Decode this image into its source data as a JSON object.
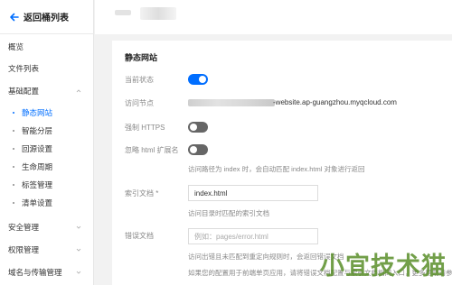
{
  "back": {
    "label": "返回桶列表"
  },
  "sidebar": {
    "items": [
      {
        "label": "概览"
      },
      {
        "label": "文件列表"
      },
      {
        "label": "基础配置"
      },
      {
        "label": "静态网站"
      },
      {
        "label": "智能分层"
      },
      {
        "label": "回源设置"
      },
      {
        "label": "生命周期"
      },
      {
        "label": "标签管理"
      },
      {
        "label": "清单设置"
      },
      {
        "label": "安全管理"
      },
      {
        "label": "权限管理"
      },
      {
        "label": "域名与传输管理"
      }
    ]
  },
  "page": {
    "title": "静态网站",
    "status_label": "当前状态",
    "endpoint_label": "访问节点",
    "endpoint_value": "-website.ap-guangzhou.myqcloud.com",
    "https_label": "强制 HTTPS",
    "ignore_html_label": "忽略 html 扩展名",
    "ignore_html_hint": "访问路径为 index 时，会自动匹配 index.html 对象进行返回",
    "index_label": "索引文档 *",
    "index_value": "index.html",
    "index_hint": "访问目录时匹配的索引文档",
    "error_label": "错误文档",
    "error_placeholder": "例如：pages/error.html",
    "error_hint": "访问出错且未匹配到重定向规则时，会返回错误文档",
    "spa_hint": "如果您的配置用于前端单页应用，请将错误文档配置与索引文档相同入口，更多帮助请参考"
  },
  "watermark": "小宜技术猫",
  "colors": {
    "accent": "#006eff",
    "toggle_off": "#666666"
  },
  "icons": {
    "back": "arrow-left-icon",
    "chevron": "chevron-down-icon"
  }
}
